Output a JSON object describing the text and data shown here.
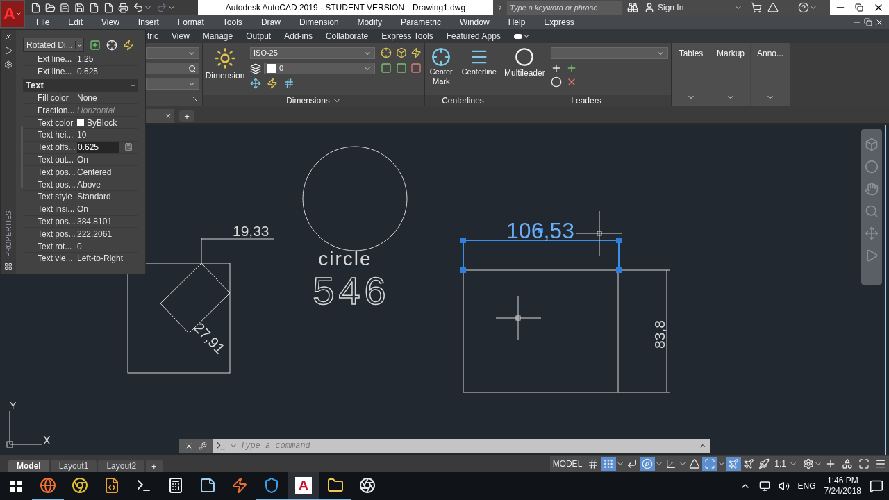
{
  "app_button": {
    "letter": "A"
  },
  "title_bar": {
    "title": "Autodesk AutoCAD 2019 - STUDENT VERSION",
    "file": "Drawing1.dwg",
    "search_placeholder": "Type a keyword or phrase",
    "sign_in": "Sign In"
  },
  "menu_bar": [
    "File",
    "Edit",
    "View",
    "Insert",
    "Format",
    "Tools",
    "Draw",
    "Dimension",
    "Modify",
    "Parametric",
    "Window",
    "Help",
    "Express"
  ],
  "ribbon_tabs": [
    "tric",
    "View",
    "Manage",
    "Output",
    "Add-ins",
    "Collaborate",
    "Express Tools",
    "Featured Apps"
  ],
  "ribbon": {
    "dimensions": {
      "button": "Dimension",
      "style": "ISO-25",
      "layer": "0",
      "footer": "Dimensions"
    },
    "centerlines": {
      "buttons": [
        "Center Mark",
        "Centerline"
      ],
      "footer": "Centerlines"
    },
    "leaders": {
      "button": "Multileader",
      "footer": "Leaders"
    },
    "collapsed": [
      "Tables",
      "Markup",
      "Anno..."
    ]
  },
  "file_tabs": {
    "close": "×",
    "add": "+"
  },
  "properties": {
    "object_type": "Rotated Di...",
    "side_label": "PROPERTIES",
    "top_rows": [
      {
        "name": "Ext line...",
        "value": "1.25"
      },
      {
        "name": "Ext line...",
        "value": "0.625"
      }
    ],
    "section": {
      "title": "Text",
      "toggle": "−",
      "expanded": true
    },
    "rows": [
      {
        "kind": "text",
        "name": "Fill color",
        "value": "None",
        "disabled": false,
        "selected": false
      },
      {
        "kind": "text",
        "name": "Fraction...",
        "value": "Horizontal",
        "disabled": true,
        "selected": false
      },
      {
        "kind": "swatch",
        "name": "Text color",
        "value": "ByBlock",
        "disabled": false,
        "selected": false
      },
      {
        "kind": "text",
        "name": "Text hei...",
        "value": "10",
        "disabled": false,
        "selected": false
      },
      {
        "kind": "text",
        "name": "Text offs...",
        "value": "0.625",
        "disabled": false,
        "selected": true
      },
      {
        "kind": "text",
        "name": "Text out...",
        "value": "On",
        "disabled": false,
        "selected": false
      },
      {
        "kind": "text",
        "name": "Text pos...",
        "value": "Centered",
        "disabled": false,
        "selected": false
      },
      {
        "kind": "text",
        "name": "Text pos...",
        "value": "Above",
        "disabled": false,
        "selected": false
      },
      {
        "kind": "text",
        "name": "Text style",
        "value": "Standard",
        "disabled": false,
        "selected": false
      },
      {
        "kind": "text",
        "name": "Text insi...",
        "value": "On",
        "disabled": false,
        "selected": false
      },
      {
        "kind": "text",
        "name": "Text pos...",
        "value": "384.8101",
        "disabled": false,
        "selected": false
      },
      {
        "kind": "text",
        "name": "Text pos...",
        "value": "222.2061",
        "disabled": false,
        "selected": false
      },
      {
        "kind": "text",
        "name": "Text rot...",
        "value": "0",
        "disabled": false,
        "selected": false
      },
      {
        "kind": "text",
        "name": "Text vie...",
        "value": "Left-to-Right",
        "disabled": false,
        "selected": false
      }
    ]
  },
  "drawing": {
    "dim_horizontal": "19,33",
    "dim_aligned": "27,91",
    "circle_label": "circle",
    "circle_number": "546",
    "dim_selected": "106,53",
    "dim_vertical": "83,8",
    "ucs_x": "X",
    "ucs_y": "Y"
  },
  "command_line": {
    "placeholder": "Type a command"
  },
  "layout_tabs": [
    {
      "label": "Model",
      "selected": true
    },
    {
      "label": "Layout1",
      "selected": false
    },
    {
      "label": "Layout2",
      "selected": false
    }
  ],
  "add_layout": "+",
  "status_bar": {
    "model": "MODEL",
    "scale": "1:1",
    "toggles": [
      {
        "on": false,
        "dropdown": false
      },
      {
        "on": true,
        "dropdown": true
      },
      {
        "on": false,
        "dropdown": false
      },
      {
        "on": true,
        "dropdown": true
      },
      {
        "on": false,
        "dropdown": true
      },
      {
        "on": false,
        "dropdown": false
      },
      {
        "on": true,
        "dropdown": true
      },
      {
        "on": true,
        "dropdown": false
      },
      {
        "on": false,
        "dropdown": false
      },
      {
        "on": false,
        "dropdown": false
      }
    ]
  },
  "taskbar": {
    "apps": [
      {
        "kind": "icon",
        "selected": false,
        "running": true
      },
      {
        "kind": "icon",
        "selected": false,
        "running": false
      },
      {
        "kind": "icon",
        "selected": false,
        "running": false
      },
      {
        "kind": "icon",
        "selected": false,
        "running": false
      },
      {
        "kind": "icon",
        "selected": false,
        "running": false
      },
      {
        "kind": "icon",
        "selected": false,
        "running": false
      },
      {
        "kind": "icon",
        "selected": false,
        "running": false
      },
      {
        "kind": "icon",
        "selected": false,
        "running": true
      },
      {
        "kind": "letter",
        "label": "A",
        "selected": true,
        "running": true
      },
      {
        "kind": "icon",
        "selected": false,
        "running": true
      },
      {
        "kind": "icon",
        "selected": false,
        "running": false
      }
    ],
    "language": "ENG",
    "time": "1:46 PM",
    "date": "7/24/2018"
  }
}
